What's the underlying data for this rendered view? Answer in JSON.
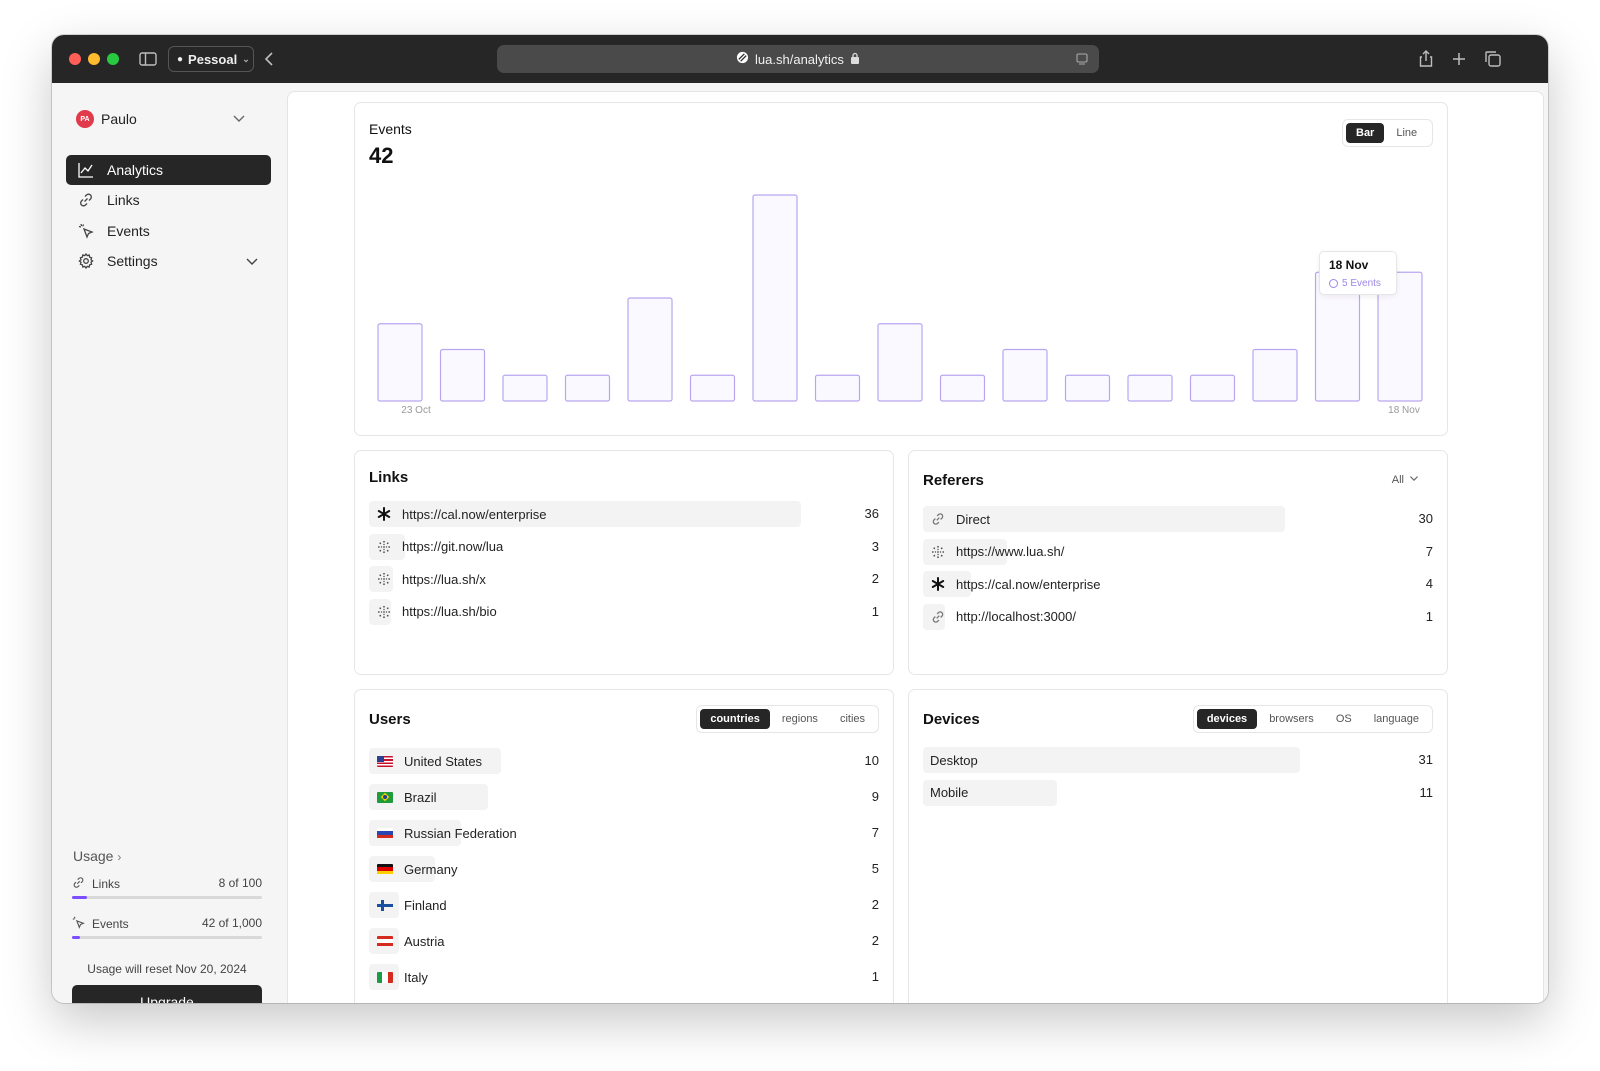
{
  "browser": {
    "profile": "Pessoal",
    "url": "lua.sh/analytics"
  },
  "sidebar": {
    "user_initials": "PA",
    "user_name": "Paulo",
    "nav": [
      {
        "label": "Analytics",
        "icon": "chart-line-icon",
        "active": true
      },
      {
        "label": "Links",
        "icon": "link-icon",
        "active": false
      },
      {
        "label": "Events",
        "icon": "cursor-click-icon",
        "active": false
      },
      {
        "label": "Settings",
        "icon": "gear-icon",
        "active": false
      }
    ],
    "usage": {
      "title": "Usage",
      "links": {
        "label": "Links",
        "count": "8 of 100",
        "fraction": 0.08
      },
      "events": {
        "label": "Events",
        "count": "42 of 1,000",
        "fraction": 0.042
      },
      "reset_note": "Usage will reset Nov 20, 2024",
      "upgrade_label": "Upgrade"
    }
  },
  "events_card": {
    "title": "Events",
    "total": "42",
    "toggle": {
      "bar": "Bar",
      "line": "Line",
      "selected": "Bar"
    },
    "tooltip": {
      "date": "18 Nov",
      "value": "5 Events"
    }
  },
  "chart_data": {
    "type": "bar",
    "title": "Events",
    "categories": [
      "23 Oct",
      "",
      "",
      "",
      "",
      "",
      "",
      "",
      "",
      "",
      "",
      "",
      "",
      "",
      "",
      "",
      "18 Nov"
    ],
    "tick_labels": [
      "23 Oct",
      "18 Nov"
    ],
    "values": [
      3,
      2,
      1,
      1,
      4,
      1,
      8,
      1,
      3,
      1,
      2,
      1,
      1,
      1,
      2,
      5,
      5
    ],
    "ylim": [
      0,
      8
    ],
    "grid": false,
    "colors": {
      "fill": "#faf9ff",
      "stroke": "#b9a6f0"
    }
  },
  "links_card": {
    "title": "Links",
    "items": [
      {
        "icon": "asterisk-icon",
        "label": "https://cal.now/enterprise",
        "value": "36",
        "fraction": 1.0
      },
      {
        "icon": "dotted-circle-icon",
        "label": "https://git.now/lua",
        "value": "3",
        "fraction": 0.083
      },
      {
        "icon": "dotted-circle-icon",
        "label": "https://lua.sh/x",
        "value": "2",
        "fraction": 0.056
      },
      {
        "icon": "dotted-circle-icon",
        "label": "https://lua.sh/bio",
        "value": "1",
        "fraction": 0.028
      }
    ]
  },
  "referers_card": {
    "title": "Referers",
    "filter": "All",
    "items": [
      {
        "icon": "link-icon",
        "label": "Direct",
        "value": "30",
        "fraction": 1.0
      },
      {
        "icon": "dotted-circle-icon",
        "label": "https://www.lua.sh/",
        "value": "7",
        "fraction": 0.233
      },
      {
        "icon": "asterisk-icon",
        "label": "https://cal.now/enterprise",
        "value": "4",
        "fraction": 0.133
      },
      {
        "icon": "link-icon",
        "label": "http://localhost:3000/",
        "value": "1",
        "fraction": 0.033
      }
    ]
  },
  "users_card": {
    "title": "Users",
    "tabs": [
      "countries",
      "regions",
      "cities"
    ],
    "selected_tab": "countries",
    "items": [
      {
        "flag": "us",
        "label": "United States",
        "value": "10",
        "fraction": 1.0
      },
      {
        "flag": "br",
        "label": "Brazil",
        "value": "9",
        "fraction": 0.9
      },
      {
        "flag": "ru",
        "label": "Russian Federation",
        "value": "7",
        "fraction": 0.7
      },
      {
        "flag": "de",
        "label": "Germany",
        "value": "5",
        "fraction": 0.5
      },
      {
        "flag": "fi",
        "label": "Finland",
        "value": "2",
        "fraction": 0.2
      },
      {
        "flag": "at",
        "label": "Austria",
        "value": "2",
        "fraction": 0.2
      },
      {
        "flag": "it",
        "label": "Italy",
        "value": "1",
        "fraction": 0.1
      }
    ]
  },
  "devices_card": {
    "title": "Devices",
    "tabs": [
      "devices",
      "browsers",
      "OS",
      "language"
    ],
    "selected_tab": "devices",
    "items": [
      {
        "label": "Desktop",
        "value": "31",
        "fraction": 1.0
      },
      {
        "label": "Mobile",
        "value": "11",
        "fraction": 0.355
      }
    ]
  }
}
